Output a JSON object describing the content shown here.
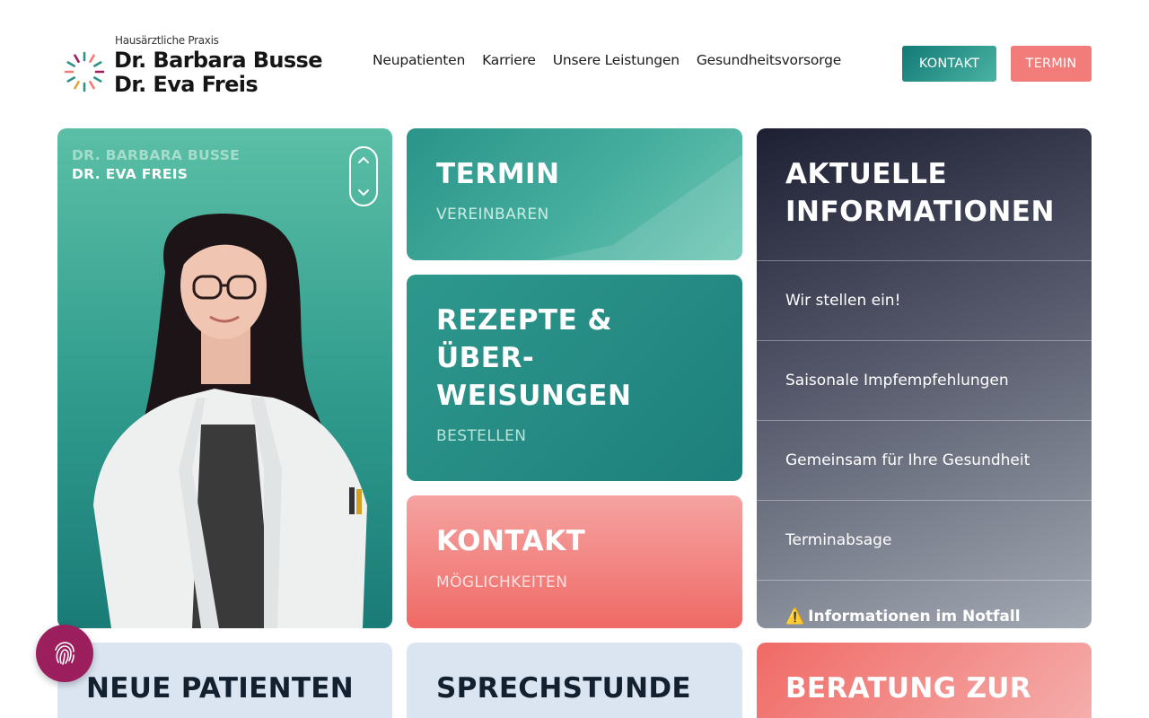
{
  "header": {
    "logo": {
      "small": "Hausärztliche Praxis",
      "line1": "Dr. Barbara Busse",
      "line2": "Dr. Eva Freis"
    },
    "nav": [
      "Neupatienten",
      "Karriere",
      "Unsere Leistungen",
      "Gesundheitsvorsorge"
    ],
    "kontakt_button": "KONTAKT",
    "termin_button": "TERMIN"
  },
  "doctor": {
    "name1": "DR. BARBARA BUSSE",
    "name2": "DR. EVA FREIS"
  },
  "termin": {
    "title": "TERMIN",
    "subtitle": "VEREINBAREN"
  },
  "rezepte": {
    "title_l1": "REZEPTE &",
    "title_l2": "ÜBER-",
    "title_l3": "WEISUNGEN",
    "subtitle": "BESTELLEN"
  },
  "kontakt": {
    "title": "KONTAKT",
    "subtitle": "MÖGLICHKEITEN"
  },
  "info": {
    "title_l1": "AKTUELLE",
    "title_l2": "INFORMATIONEN",
    "items": [
      "Wir stellen ein!",
      "Saisonale Impfempfehlungen",
      "Gemeinsam für Ihre Gesundheit",
      "Terminabsage"
    ],
    "notfall_icon": "⚠️",
    "notfall": "Informationen im Notfall"
  },
  "bottom": {
    "neue": "NEUE PATIENTEN",
    "sprech": "SPRECHSTUNDE",
    "beratung": "BERATUNG ZUR"
  },
  "colors": {
    "teal": "#2a948a",
    "coral": "#f17c79",
    "dark": "#1d1f33",
    "light_blue": "#dbe5f2",
    "accessibility_button": "#9b1f5c"
  }
}
